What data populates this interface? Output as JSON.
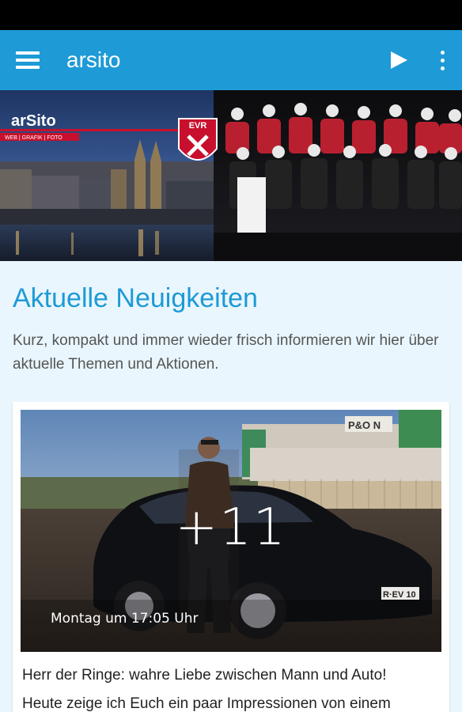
{
  "app": {
    "title": "arsito"
  },
  "banner": {
    "logo_text": "arSito",
    "logo_sub": "WEB | GRAFIK | FOTO",
    "badge": "EVR"
  },
  "news": {
    "title": "Aktuelle Neuigkeiten",
    "description": "Kurz, kompakt und immer wieder frisch informieren wir hier über aktuelle Themen und Aktionen."
  },
  "post": {
    "photo_count": "+11",
    "date": "Montag um 17:05 Uhr",
    "text_line1": "Herr der Ringe: wahre Liebe zwischen Mann und Auto!",
    "text_line2": "Heute zeige ich Euch ein paar Impressionen von einem",
    "plate": "R·EV 10"
  },
  "colors": {
    "accent": "#1e9ad6",
    "background": "#e9f6fd"
  }
}
